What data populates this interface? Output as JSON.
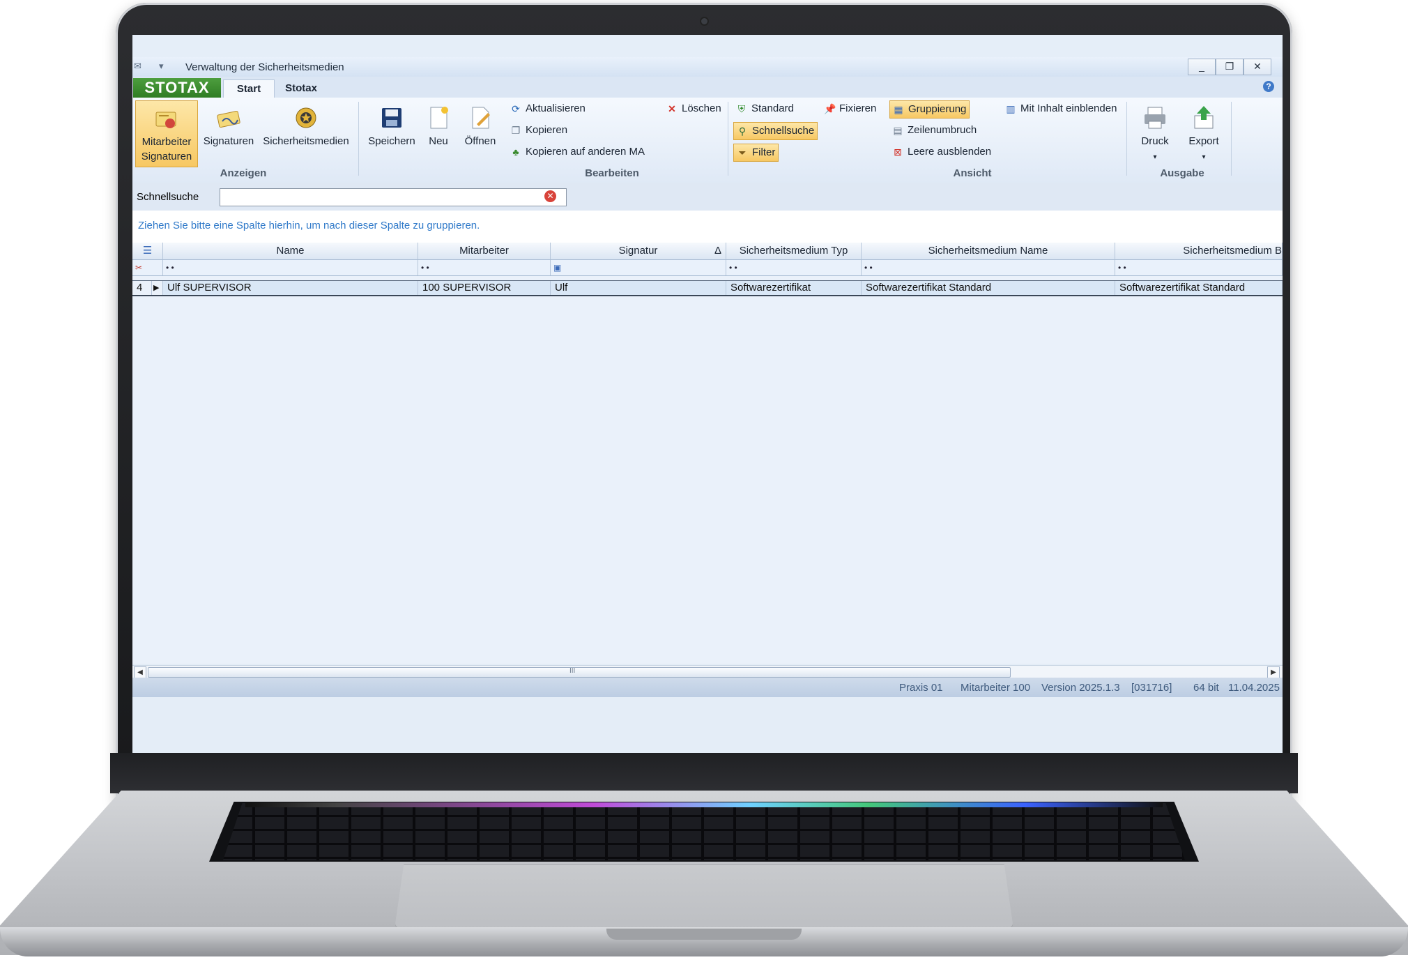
{
  "window": {
    "title": "Verwaltung der Sicherheitsmedien",
    "controls": {
      "minimize": "_",
      "restore": "❐",
      "close": "✕"
    }
  },
  "brand": {
    "logo": "STOTAX",
    "color": "#3a8a2e"
  },
  "tabs": [
    {
      "label": "Start"
    },
    {
      "label": "Stotax"
    }
  ],
  "ribbon": {
    "groups": {
      "anzeigen": "Anzeigen",
      "bearbeiten": "Bearbeiten",
      "ansicht": "Ansicht",
      "ausgabe": "Ausgabe"
    },
    "anzeigen": {
      "mitarbeiter_signaturen_1": "Mitarbeiter",
      "mitarbeiter_signaturen_2": "Signaturen",
      "signaturen": "Signaturen",
      "sicherheitsmedien": "Sicherheitsmedien"
    },
    "bearbeiten": {
      "speichern": "Speichern",
      "neu": "Neu",
      "oeffnen": "Öffnen",
      "aktualisieren": "Aktualisieren",
      "kopieren": "Kopieren",
      "kopieren_ma": "Kopieren auf anderen MA",
      "loeschen": "Löschen"
    },
    "ansicht": {
      "standard": "Standard",
      "fixieren": "Fixieren",
      "schnellsuche": "Schnellsuche",
      "filter": "Filter",
      "gruppierung": "Gruppierung",
      "zeilenumbruch": "Zeilenumbruch",
      "leere_ausblenden": "Leere ausblenden",
      "mit_inhalt": "Mit Inhalt einblenden"
    },
    "ausgabe": {
      "druck": "Druck",
      "export": "Export"
    }
  },
  "search": {
    "label": "Schnellsuche",
    "value": ""
  },
  "group_hint": "Ziehen Sie bitte eine Spalte hierhin, um nach dieser Spalte zu gruppieren.",
  "grid": {
    "columns": [
      "Name",
      "Mitarbeiter",
      "Signatur",
      "Sicherheitsmedium Typ",
      "Sicherheitsmedium Name",
      "Sicherheitsmedium B"
    ],
    "sort_indicator": "Δ",
    "filter_glyph": "• •",
    "rows": [
      {
        "index": "4",
        "cells": [
          "Ulf SUPERVISOR",
          "100 SUPERVISOR",
          "Ulf",
          "Softwarezertifikat",
          "Softwarezertifikat Standard",
          "Softwarezertifikat Standard"
        ]
      }
    ]
  },
  "scrollbar": {
    "grip": "III"
  },
  "status": {
    "praxis": "Praxis 01",
    "mitarbeiter": "Mitarbeiter 100",
    "version": "Version 2025.1.3",
    "build": "[031716]",
    "arch": "64 bit",
    "date": "11.04.2025"
  }
}
